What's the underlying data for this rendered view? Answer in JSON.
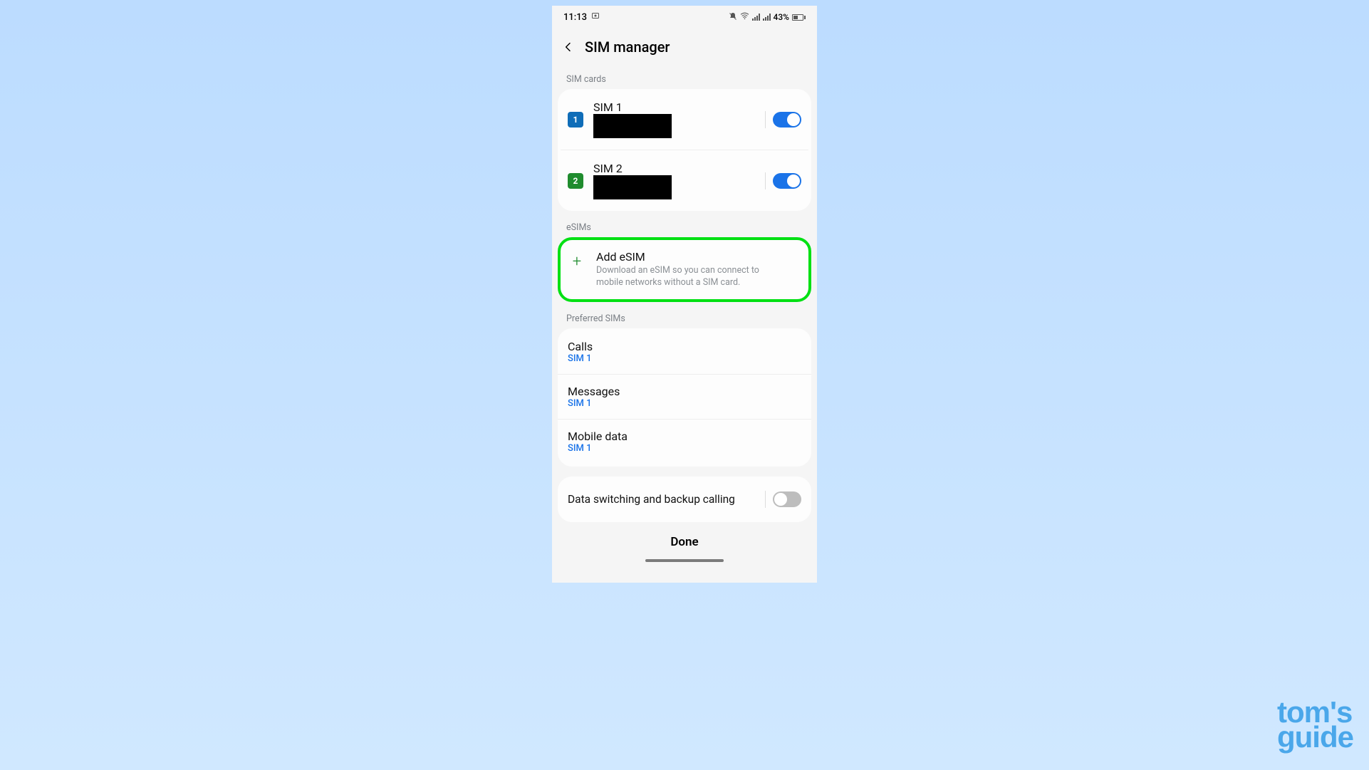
{
  "status": {
    "time": "11:13",
    "battery": "43%"
  },
  "header": {
    "title": "SIM manager"
  },
  "sections": {
    "sim_cards_label": "SIM cards",
    "esims_label": "eSIMs",
    "preferred_label": "Preferred SIMs"
  },
  "sim": {
    "sim1": {
      "chip": "1",
      "title": "SIM 1"
    },
    "sim2": {
      "chip": "2",
      "title": "SIM 2"
    }
  },
  "esim": {
    "title": "Add eSIM",
    "desc": "Download an eSIM so you can connect to mobile networks without a SIM card."
  },
  "preferred": {
    "calls": {
      "title": "Calls",
      "value": "SIM 1"
    },
    "messages": {
      "title": "Messages",
      "value": "SIM 1"
    },
    "mobile_data": {
      "title": "Mobile data",
      "value": "SIM 1"
    }
  },
  "data_switching": {
    "title": "Data switching and backup calling"
  },
  "done": "Done",
  "watermark": {
    "line1": "tom's",
    "line2": "guide"
  }
}
